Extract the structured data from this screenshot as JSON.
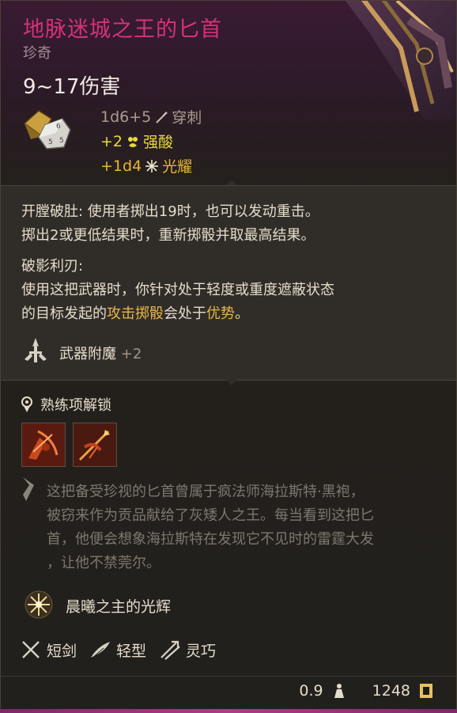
{
  "item": {
    "name": "地脉迷城之王的匕首",
    "rarity": "珍奇",
    "damage_range": "9~17伤害"
  },
  "damage_lines": [
    {
      "dice": "1d6+5",
      "type": "穿刺",
      "icon": "arrow-icon"
    },
    {
      "dice": "+2",
      "type": "强酸",
      "icon": "acid-drops-icon"
    },
    {
      "dice": "+1d4",
      "type": "光耀",
      "icon": "radiant-star-icon"
    }
  ],
  "effects": {
    "effect1_name": "开膛破肚",
    "effect1_text1": ": 使用者掷出19时，也可以发动重击。",
    "effect1_text2": "掷出2或更低结果时，重新掷骰并取最高结果。",
    "effect2_name": "破影利刃:",
    "effect2_text1": "使用这把武器时，你针对处于轻度或重度遮蔽状态",
    "effect2_text2a": "的目标发起的",
    "effect2_text2b": "攻击掷骰",
    "effect2_text2c": "会处于",
    "effect2_text2d": "优势",
    "effect2_text2e": "。"
  },
  "enchantment": {
    "label": "武器附魔",
    "value": "+2"
  },
  "proficiency": {
    "label": "熟练项解锁",
    "actions": [
      "action-slash-icon",
      "action-pierce-icon"
    ]
  },
  "lore": [
    "这把备受珍视的匕首曾属于疯法师海拉斯特·黑袍，",
    "被窃来作为贡品献给了灰矮人之王。每当看到这把匕",
    "首，他便会想象海拉斯特在发现它不见时的雷霆大发",
    "，让他不禁莞尔。"
  ],
  "passive": {
    "label": "晨曦之主的光辉"
  },
  "tags": [
    {
      "label": "短剑",
      "icon": "crossed-swords-icon"
    },
    {
      "label": "轻型",
      "icon": "feather-icon"
    },
    {
      "label": "灵巧",
      "icon": "finesse-arrows-icon"
    }
  ],
  "footer": {
    "weight": "0.9",
    "value": "1248"
  },
  "colors": {
    "title": "#d6327a",
    "acid": "#e8d93a",
    "radiant": "#e9b732",
    "highlight": "#e8b54a"
  }
}
